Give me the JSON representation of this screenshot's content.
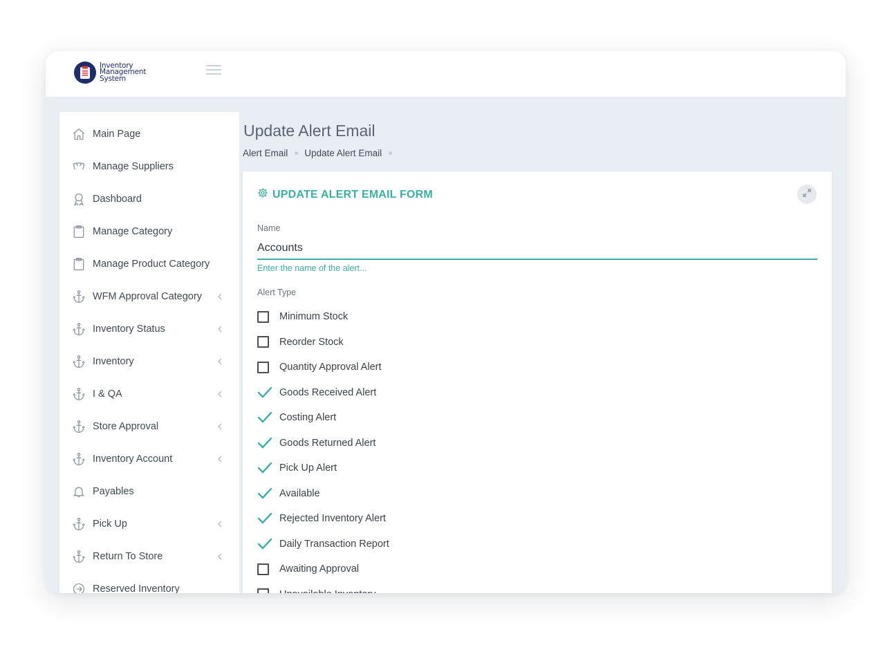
{
  "app": {
    "logo_lines": [
      "Inventory",
      "Management",
      "System"
    ]
  },
  "sidebar": {
    "items": [
      {
        "label": "Main Page",
        "icon": "home-icon",
        "has_chevron": false
      },
      {
        "label": "Manage Suppliers",
        "icon": "supplier-icon",
        "has_chevron": false
      },
      {
        "label": "Dashboard",
        "icon": "award-icon",
        "has_chevron": false
      },
      {
        "label": "Manage Category",
        "icon": "clipboard-icon",
        "has_chevron": false
      },
      {
        "label": "Manage Product Category",
        "icon": "clipboard-icon",
        "has_chevron": false
      },
      {
        "label": "WFM Approval Category",
        "icon": "anchor-icon",
        "has_chevron": true
      },
      {
        "label": "Inventory Status",
        "icon": "anchor-icon",
        "has_chevron": true
      },
      {
        "label": "Inventory",
        "icon": "anchor-icon",
        "has_chevron": true
      },
      {
        "label": "I & QA",
        "icon": "anchor-icon",
        "has_chevron": true
      },
      {
        "label": "Store Approval",
        "icon": "anchor-icon",
        "has_chevron": true
      },
      {
        "label": "Inventory Account",
        "icon": "anchor-icon",
        "has_chevron": true
      },
      {
        "label": "Payables",
        "icon": "bell-icon",
        "has_chevron": false
      },
      {
        "label": "Pick Up",
        "icon": "anchor-icon",
        "has_chevron": true
      },
      {
        "label": "Return To Store",
        "icon": "anchor-icon",
        "has_chevron": true
      },
      {
        "label": "Reserved Inventory",
        "icon": "arrow-circle-icon",
        "has_chevron": false
      }
    ]
  },
  "page": {
    "title": "Update Alert Email",
    "breadcrumb": [
      "Alert Email",
      "Update Alert Email"
    ]
  },
  "form": {
    "title": "UPDATE ALERT EMAIL FORM",
    "name_label": "Name",
    "name_value": "Accounts",
    "name_hint": "Enter the name of the alert...",
    "alert_type_label": "Alert Type",
    "alert_types": [
      {
        "label": "Minimum Stock",
        "checked": false
      },
      {
        "label": "Reorder Stock",
        "checked": false
      },
      {
        "label": "Quantity Approval Alert",
        "checked": false
      },
      {
        "label": "Goods Received Alert",
        "checked": true
      },
      {
        "label": "Costing Alert",
        "checked": true
      },
      {
        "label": "Goods Returned Alert",
        "checked": true
      },
      {
        "label": "Pick Up Alert",
        "checked": true
      },
      {
        "label": "Available",
        "checked": true
      },
      {
        "label": "Rejected Inventory Alert",
        "checked": true
      },
      {
        "label": "Daily Transaction Report",
        "checked": true
      },
      {
        "label": "Awaiting Approval",
        "checked": false
      },
      {
        "label": "Unavailable Inventory",
        "checked": false
      }
    ]
  },
  "colors": {
    "accent": "#3eaea3",
    "brand": "#1f2d6b",
    "background": "#e9edf4"
  }
}
